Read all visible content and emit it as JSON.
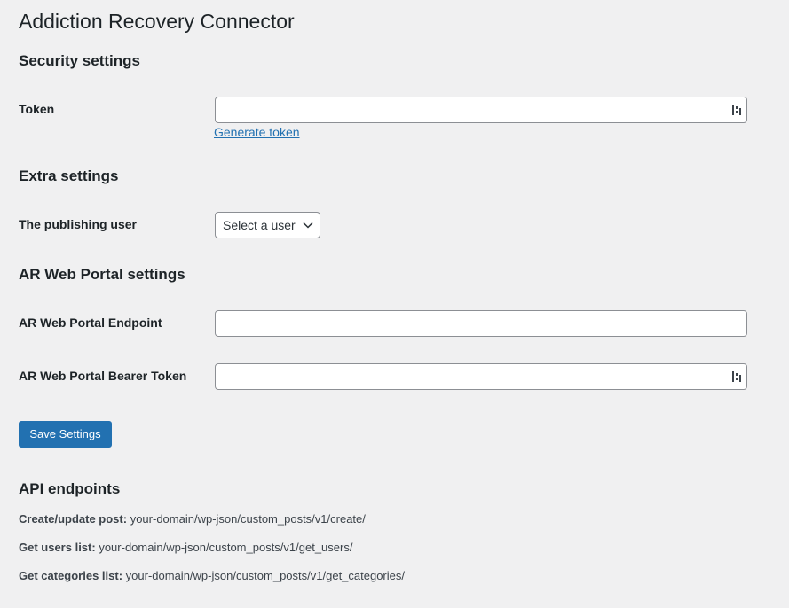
{
  "page": {
    "title": "Addiction Recovery Connector"
  },
  "security": {
    "heading": "Security settings",
    "token_label": "Token",
    "token_value": "",
    "generate_link": "Generate token",
    "token_icon": "key-icon"
  },
  "extra": {
    "heading": "Extra settings",
    "publishing_user_label": "The publishing user",
    "publishing_user_selected": "Select a user"
  },
  "portal": {
    "heading": "AR Web Portal settings",
    "endpoint_label": "AR Web Portal Endpoint",
    "endpoint_value": "",
    "bearer_label": "AR Web Portal Bearer Token",
    "bearer_value": ""
  },
  "actions": {
    "save_label": "Save Settings"
  },
  "api": {
    "heading": "API endpoints",
    "items": [
      {
        "label": "Create/update post:",
        "path": "your-domain/wp-json/custom_posts/v1/create/"
      },
      {
        "label": "Get users list:",
        "path": "your-domain/wp-json/custom_posts/v1/get_users/"
      },
      {
        "label": "Get categories list:",
        "path": "your-domain/wp-json/custom_posts/v1/get_categories/"
      }
    ]
  },
  "colors": {
    "background": "#f0f0f1",
    "primary": "#2271b1",
    "text": "#1d2327",
    "border": "#8c8f94"
  }
}
